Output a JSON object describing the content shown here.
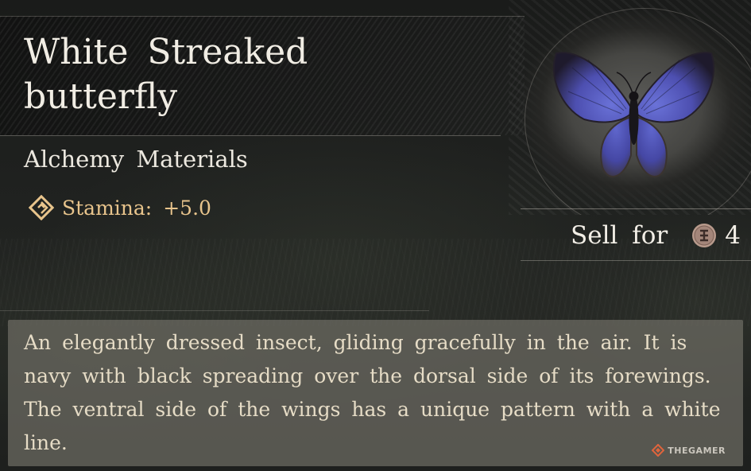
{
  "item": {
    "name": "White Streaked butterfly",
    "category": "Alchemy Materials",
    "stat": {
      "icon": "stamina-diamond-icon",
      "label": "Stamina:",
      "value": "+5.0",
      "color": "#e8c48c"
    },
    "image": "blue-butterfly-specimen"
  },
  "sell": {
    "label": "Sell for",
    "currency_icon": "coin-icon",
    "price": "4"
  },
  "description": {
    "text": "An elegantly dressed insect, gliding gracefully in the air. It is navy with black spreading over the dorsal side of its forewings. The ventral side of the wings has a unique pattern with a white line."
  },
  "watermark": {
    "icon": "thegamer-logo-icon",
    "text": "THEGAMER"
  },
  "colors": {
    "title_text": "#f1ede4",
    "description_text": "#e6dcc6",
    "description_panel": "#6e6c64",
    "butterfly_wing": "#5a5fc4"
  }
}
